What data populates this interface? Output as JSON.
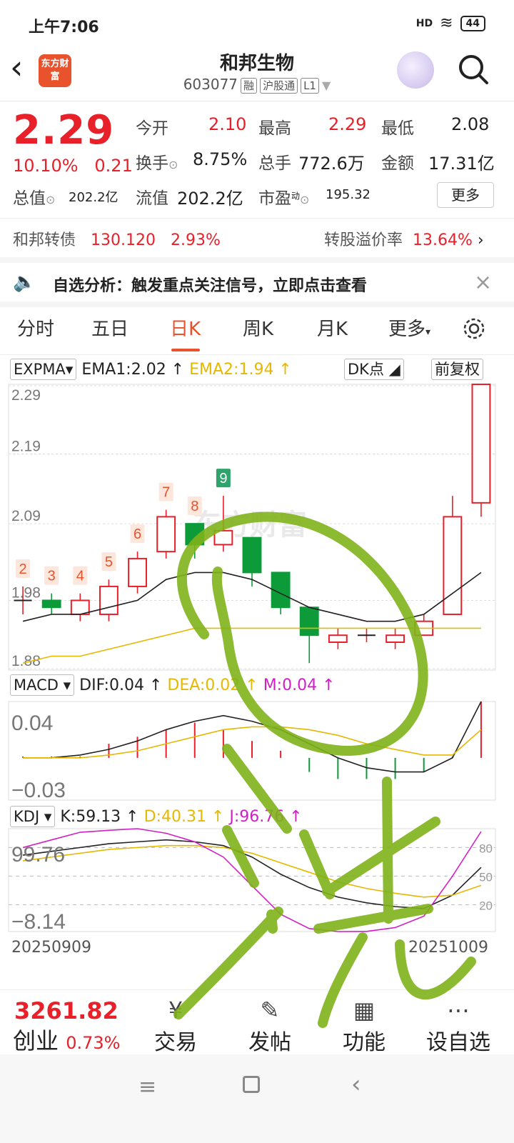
{
  "status": {
    "time": "上午7:06",
    "signal": "HD",
    "battery": "44"
  },
  "header": {
    "title": "和邦生物",
    "code": "603077",
    "tags": [
      "融",
      "沪股通",
      "L1"
    ],
    "logo_text": "东方财富"
  },
  "quote": {
    "price": "2.29",
    "change_pct": "10.10%",
    "change_amt": "0.21",
    "open_label": "今开",
    "open": "2.10",
    "high_label": "最高",
    "high": "2.29",
    "low_label": "最低",
    "low": "2.08",
    "turnover_label": "换手",
    "turnover": "8.75%",
    "volume_label": "总手",
    "volume": "772.6万",
    "amount_label": "金额",
    "amount": "17.31亿",
    "mktcap_label": "总值",
    "mktcap": "202.2亿",
    "float_label": "流值",
    "float": "202.2亿",
    "pe_label": "市盈",
    "pe_sup": "动",
    "pe": "195.32",
    "more": "更多"
  },
  "bond": {
    "name": "和邦转债",
    "price": "130.120",
    "pct": "2.93%",
    "premium_label": "转股溢价率",
    "premium": "13.64%"
  },
  "notice": {
    "text": "自选分析：触发重点关注信号，立即点击查看"
  },
  "tabs": [
    "分时",
    "五日",
    "日K",
    "周K",
    "月K",
    "更多"
  ],
  "active_tab": 2,
  "indicators": {
    "main": {
      "name": "EXPMA",
      "ema1": "EMA1:2.02",
      "ema2": "EMA2:1.94",
      "dk": "DK点",
      "adjust": "前复权"
    },
    "macd": {
      "name": "MACD",
      "dif": "DIF:0.04",
      "dea": "DEA:0.02",
      "m": "M:0.04",
      "top": "0.04",
      "bottom": "−0.03"
    },
    "kdj": {
      "name": "KDJ",
      "k": "K:59.13",
      "d": "D:40.31",
      "j": "J:96.76",
      "top": "99.76",
      "bottom": "−8.14",
      "levels": [
        "80",
        "50",
        "20"
      ]
    }
  },
  "chart_data": {
    "type": "candlestick",
    "price_axis": [
      "2.29",
      "2.19",
      "2.09",
      "1.98",
      "1.88"
    ],
    "ylim": [
      1.88,
      2.29
    ],
    "start_date": "20250909",
    "end_date": "20251009",
    "candles": [
      {
        "o": 1.98,
        "h": 2.0,
        "l": 1.96,
        "c": 1.98
      },
      {
        "o": 1.98,
        "h": 1.99,
        "l": 1.96,
        "c": 1.97
      },
      {
        "o": 1.96,
        "h": 1.99,
        "l": 1.95,
        "c": 1.98
      },
      {
        "o": 1.96,
        "h": 2.01,
        "l": 1.95,
        "c": 2.0
      },
      {
        "o": 2.0,
        "h": 2.05,
        "l": 1.99,
        "c": 2.04
      },
      {
        "o": 2.05,
        "h": 2.11,
        "l": 2.04,
        "c": 2.1
      },
      {
        "o": 2.09,
        "h": 2.09,
        "l": 2.04,
        "c": 2.06
      },
      {
        "o": 2.06,
        "h": 2.13,
        "l": 2.05,
        "c": 2.08
      },
      {
        "o": 2.07,
        "h": 2.07,
        "l": 2.0,
        "c": 2.02
      },
      {
        "o": 2.02,
        "h": 2.02,
        "l": 1.96,
        "c": 1.97
      },
      {
        "o": 1.97,
        "h": 1.97,
        "l": 1.89,
        "c": 1.93
      },
      {
        "o": 1.92,
        "h": 1.94,
        "l": 1.91,
        "c": 1.93
      },
      {
        "o": 1.93,
        "h": 1.94,
        "l": 1.92,
        "c": 1.93
      },
      {
        "o": 1.92,
        "h": 1.94,
        "l": 1.91,
        "c": 1.93
      },
      {
        "o": 1.93,
        "h": 1.96,
        "l": 1.93,
        "c": 1.95
      },
      {
        "o": 1.96,
        "h": 2.13,
        "l": 1.96,
        "c": 2.1
      },
      {
        "o": 2.12,
        "h": 2.29,
        "l": 2.1,
        "c": 2.29
      }
    ],
    "ema1": [
      1.95,
      1.96,
      1.96,
      1.97,
      1.98,
      2.01,
      2.02,
      2.02,
      2.01,
      1.99,
      1.97,
      1.96,
      1.95,
      1.95,
      1.96,
      1.99,
      2.02
    ],
    "ema2": [
      1.89,
      1.9,
      1.9,
      1.91,
      1.92,
      1.93,
      1.94,
      1.94,
      1.94,
      1.94,
      1.94,
      1.94,
      1.94,
      1.94,
      1.94,
      1.94,
      1.94
    ],
    "td_labels": [
      {
        "i": 0,
        "t": "2"
      },
      {
        "i": 1,
        "t": "3"
      },
      {
        "i": 2,
        "t": "4"
      },
      {
        "i": 3,
        "t": "5"
      },
      {
        "i": 4,
        "t": "6"
      },
      {
        "i": 5,
        "t": "7"
      },
      {
        "i": 6,
        "t": "8"
      },
      {
        "i": 7,
        "t": "9"
      }
    ],
    "macd_bars": [
      0.0,
      0.0,
      0.0,
      0.01,
      0.015,
      0.02,
      0.025,
      0.02,
      0.012,
      0.005,
      -0.01,
      -0.015,
      -0.015,
      -0.015,
      -0.01,
      0.0,
      0.04
    ],
    "dif": [
      0.0,
      0.0,
      0.002,
      0.006,
      0.012,
      0.02,
      0.026,
      0.03,
      0.026,
      0.02,
      0.01,
      0.0,
      -0.007,
      -0.01,
      -0.01,
      0.0,
      0.04
    ],
    "dea": [
      0.0,
      0.0,
      0.0,
      0.002,
      0.005,
      0.01,
      0.015,
      0.02,
      0.022,
      0.022,
      0.02,
      0.016,
      0.01,
      0.006,
      0.002,
      0.002,
      0.02
    ],
    "macd_ylim": [
      -0.03,
      0.04
    ],
    "kdj_k": [
      72,
      76,
      80,
      84,
      86,
      88,
      86,
      82,
      70,
      52,
      38,
      28,
      22,
      18,
      16,
      30,
      59.13
    ],
    "kdj_d": [
      66,
      70,
      74,
      78,
      80,
      82,
      82,
      80,
      74,
      64,
      54,
      44,
      37,
      32,
      28,
      30,
      40.31
    ],
    "kdj_j": [
      80,
      88,
      96,
      98,
      99.76,
      95,
      86,
      70,
      40,
      10,
      -5,
      -8.14,
      -8,
      -4,
      8,
      50,
      96.76
    ],
    "kdj_ylim": [
      -8.14,
      99.76
    ]
  },
  "market": {
    "index": "3261.82",
    "name": "创业",
    "pct": "0.73%"
  },
  "bottom_nav": [
    {
      "icon": "trade-icon",
      "label": "交易",
      "glyph": "¥"
    },
    {
      "icon": "post-icon",
      "label": "发帖",
      "glyph": "✎"
    },
    {
      "icon": "function-icon",
      "label": "功能",
      "glyph": "▦"
    },
    {
      "icon": "watchlist-icon",
      "label": "设自选",
      "glyph": "⋯"
    }
  ],
  "colors": {
    "up": "#e8202a",
    "down": "#0d9b3a",
    "ema1": "#222222",
    "ema2": "#e6b800",
    "j": "#d21fc6",
    "accent": "#e8532d",
    "scribble": "#7fb21a"
  }
}
